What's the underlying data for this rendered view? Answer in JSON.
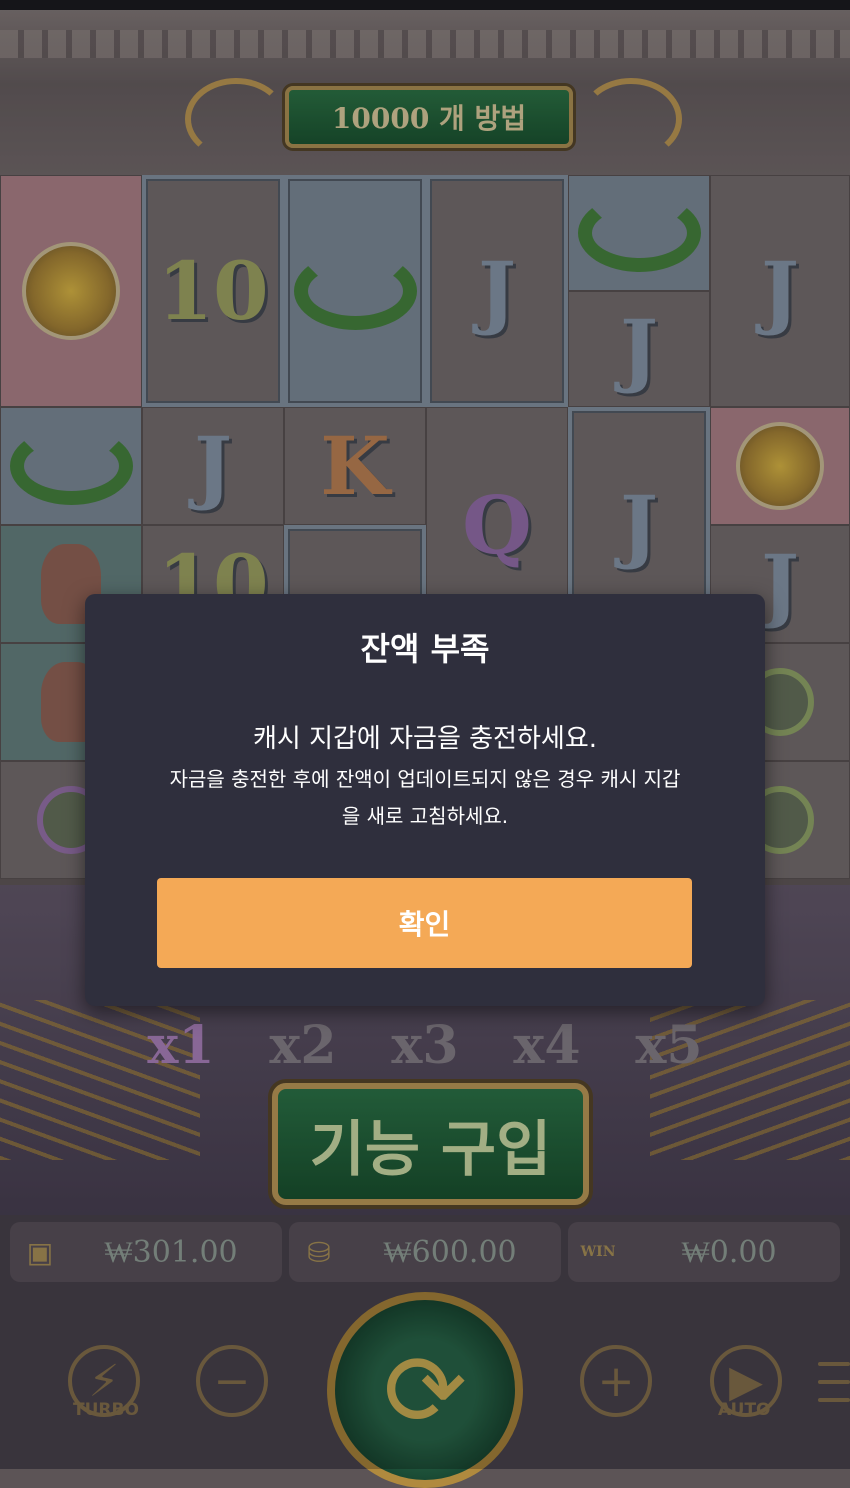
{
  "game": {
    "ways_banner": "10000 개 방법",
    "buy_feature_label": "기능 구입",
    "multipliers": [
      "x1",
      "x2",
      "x3",
      "x4",
      "x5"
    ],
    "active_multiplier": "x1",
    "balance": "₩301.00",
    "bet": "₩600.00",
    "win": "₩0.00",
    "win_badge": "WIN",
    "turbo_label": "TURBO",
    "auto_label": "AUTO",
    "reel_symbols": [
      "10",
      "J",
      "J",
      "J",
      "J",
      "K",
      "Q",
      "J",
      "J",
      "10"
    ]
  },
  "modal": {
    "title": "잔액 부족",
    "message": "캐시 지갑에 자금을 충전하세요.",
    "sub_message": "자금을 충전한 후에 잔액이 업데이트되지 않은 경우 캐시 지갑을 새로 고침하세요.",
    "confirm_label": "확인"
  },
  "colors": {
    "modal_bg": "#2f2f3d",
    "confirm_button": "#f4a956"
  }
}
